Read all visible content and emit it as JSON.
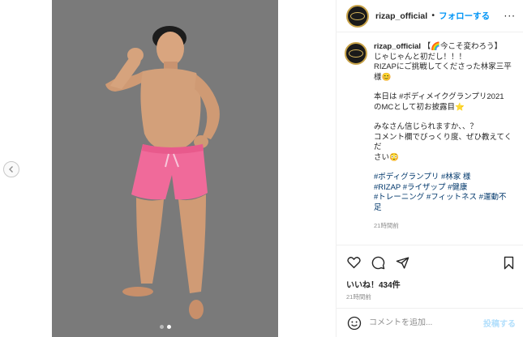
{
  "header": {
    "username": "rizap_official",
    "separator": "•",
    "follow_label": "フォローする",
    "more_label": "···"
  },
  "caption": {
    "username": "rizap_official",
    "lines": [
      "【🌈今こそ変わろう】",
      "じゃじゃんと初だし！！！",
      "RIZAPにご挑戦してくださった林家三平",
      "様😊"
    ],
    "para2": [
      "本日は #ボディメイクグランプリ2021",
      "のMCとして初お披露目⭐"
    ],
    "para3": [
      "みなさん信じられますか、、？",
      "コメント欄でびっくり度、ぜひ教えてくだ",
      "さい😳"
    ],
    "hashtags": [
      "#ボディグランプリ #林家 様",
      "#RIZAP #ライザップ #健康",
      "#トレーニング #フィットネス #運動不",
      "足"
    ],
    "time": "21時間前"
  },
  "post": {
    "likes": "いいね！434件",
    "time": "21時間前"
  },
  "comment": {
    "placeholder": "コメントを追加...",
    "post_label": "投稿する"
  },
  "icons": {
    "like": "heart-icon",
    "comment": "comment-icon",
    "share": "share-icon",
    "save": "bookmark-icon",
    "emoji": "emoji-icon",
    "prev": "chevron-left-icon"
  },
  "carousel": {
    "total": 2,
    "active": 2
  },
  "colors": {
    "accent": "#0095f6",
    "photo_bg": "#7a7a7a",
    "shorts": "#f06a9a"
  }
}
